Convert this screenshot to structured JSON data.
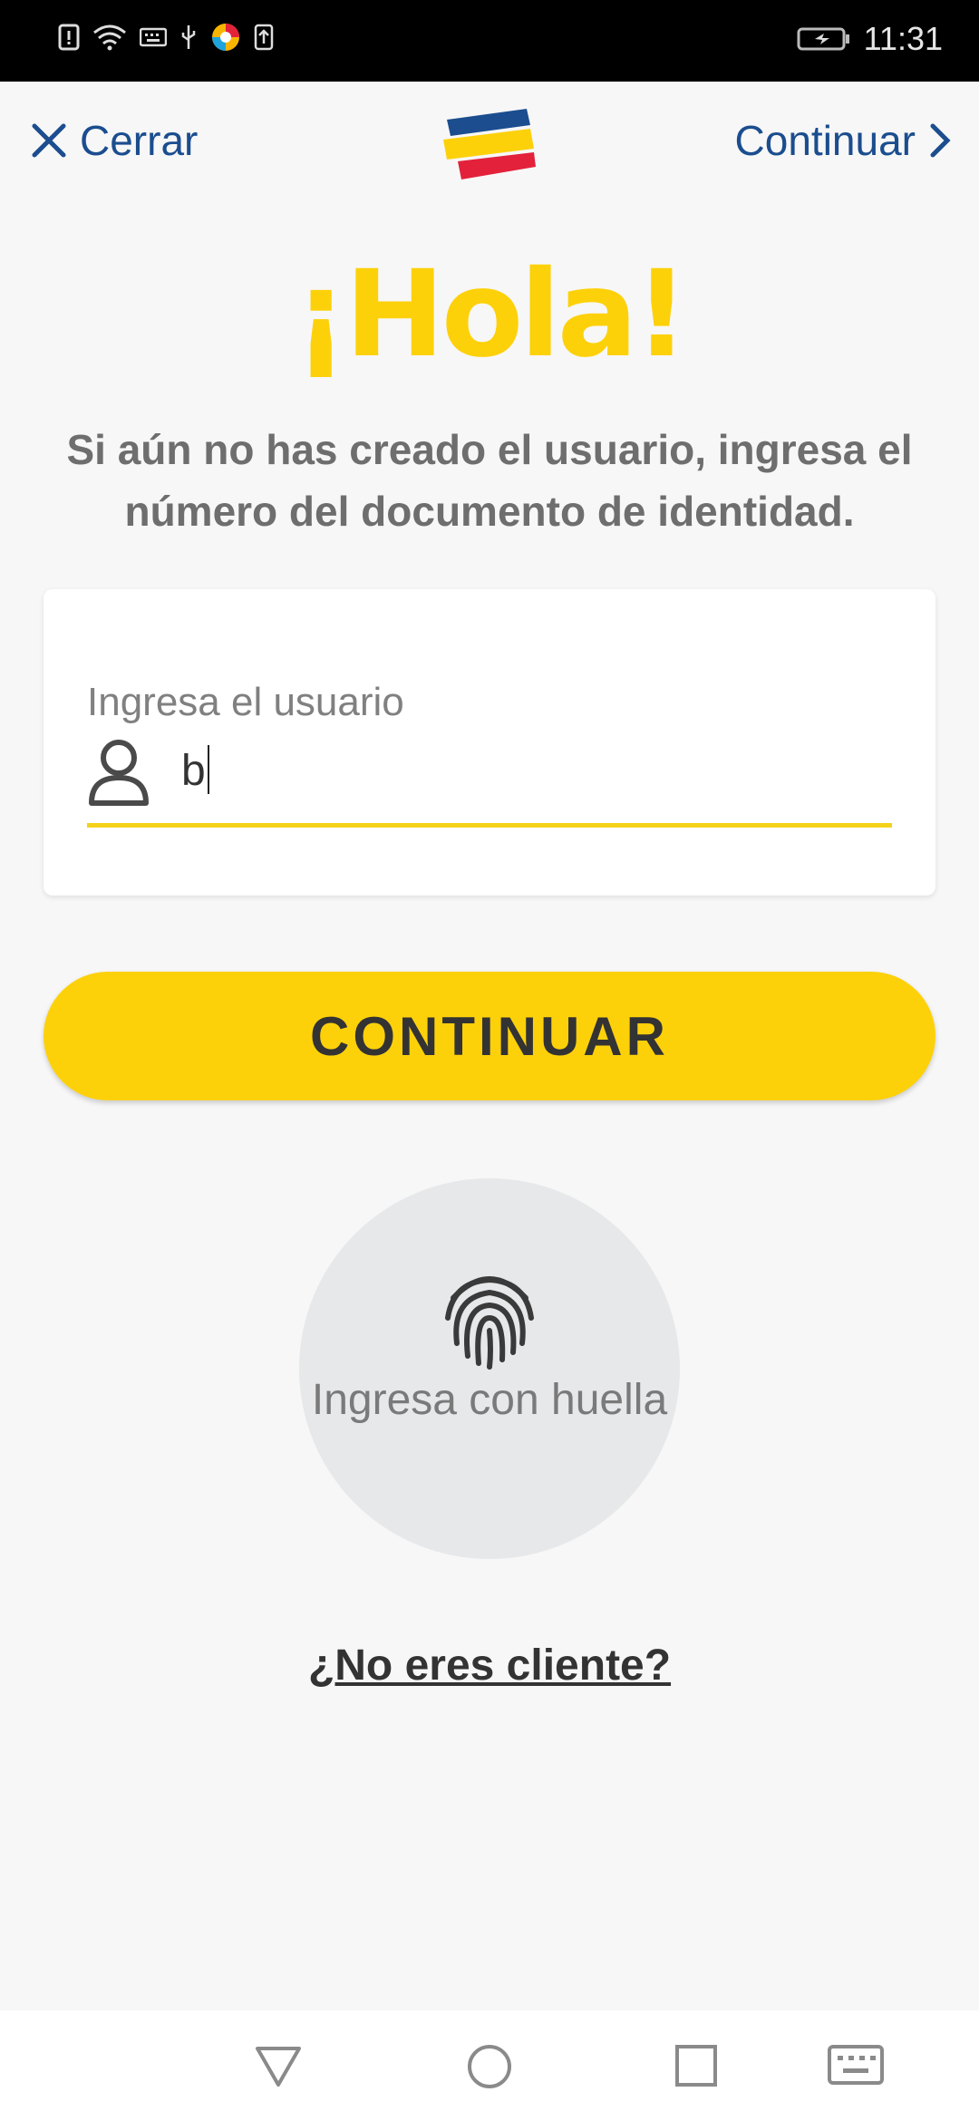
{
  "status_bar": {
    "time": "11:31",
    "icons": [
      "alert-icon",
      "wifi-icon",
      "keyboard-icon",
      "usb-icon",
      "app-icon",
      "upload-icon",
      "battery-icon"
    ]
  },
  "nav": {
    "close_label": "Cerrar",
    "continue_label": "Continuar",
    "link_color": "#1b4d8f"
  },
  "greeting": {
    "title": "¡Hola!",
    "subtitle": "Si aún no has creado el usuario, ingresa el número del documento de identidad."
  },
  "user_field": {
    "label": "Ingresa el usuario",
    "value": "b"
  },
  "primary_button": {
    "label": "CONTINUAR"
  },
  "fingerprint": {
    "label": "Ingresa con huella"
  },
  "links": {
    "not_client": "¿No eres cliente?"
  },
  "colors": {
    "brand_yellow": "#fdd10a",
    "brand_blue": "#1b4d8f",
    "brand_red": "#e3213b"
  }
}
